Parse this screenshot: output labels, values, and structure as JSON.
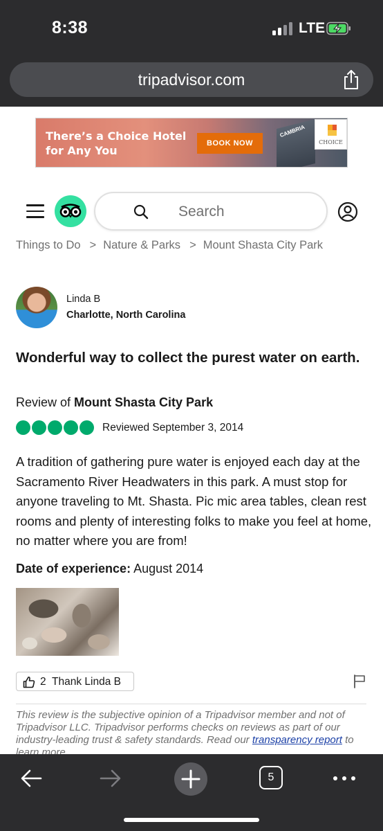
{
  "status": {
    "time": "8:38",
    "network": "LTE"
  },
  "browser": {
    "url": "tripadvisor.com"
  },
  "ad": {
    "headline": "There’s a Choice Hotel for Any You",
    "button_label": "BOOK NOW",
    "building_sign": "CAMBRIA",
    "logo_text": "CHOICE"
  },
  "header": {
    "search_placeholder": "Search"
  },
  "breadcrumb": {
    "items": [
      "Things to Do",
      "Nature & Parks",
      "Mount Shasta City Park"
    ]
  },
  "review": {
    "author": "Linda B",
    "location": "Charlotte, North Carolina",
    "title": "Wonderful way to collect the purest water on earth.",
    "review_of_prefix": "Review of",
    "place": "Mount Shasta City Park",
    "rating": 5,
    "reviewed": "Reviewed September 3, 2014",
    "body": "A tradition of gathering pure water is enjoyed each day at the Sacramento River Headwaters in this park. A must stop for anyone traveling to Mt. Shasta. Pic mic area tables, clean rest rooms and plenty of interesting folks to make you feel at home, no matter where you are from!",
    "experience_label": "Date of experience:",
    "experience_date": "August 2014",
    "thanks_count": "2",
    "thank_label": "Thank Linda B"
  },
  "disclaimer": {
    "text": "This review is the subjective opinion of a Tripadvisor member and not of Tripadvisor LLC. Tripadvisor performs checks on reviews as part of our industry-leading trust & safety standards. Read our",
    "link": "transparency report",
    "suffix": "to learn more."
  },
  "toolbar": {
    "tabs_count": "5"
  },
  "colors": {
    "brand_green": "#34e0a1",
    "rating_green": "#00aa6c",
    "chrome_dark": "#2c2c2e",
    "ad_button": "#e46c0a",
    "link_blue": "#1a3fa6"
  },
  "icons": [
    "share-icon",
    "hamburger-icon",
    "owl-logo-icon",
    "search-icon",
    "user-icon",
    "thumbs-up-icon",
    "flag-icon",
    "back-arrow-icon",
    "forward-arrow-icon",
    "new-tab-icon",
    "tabs-icon",
    "more-icon"
  ]
}
